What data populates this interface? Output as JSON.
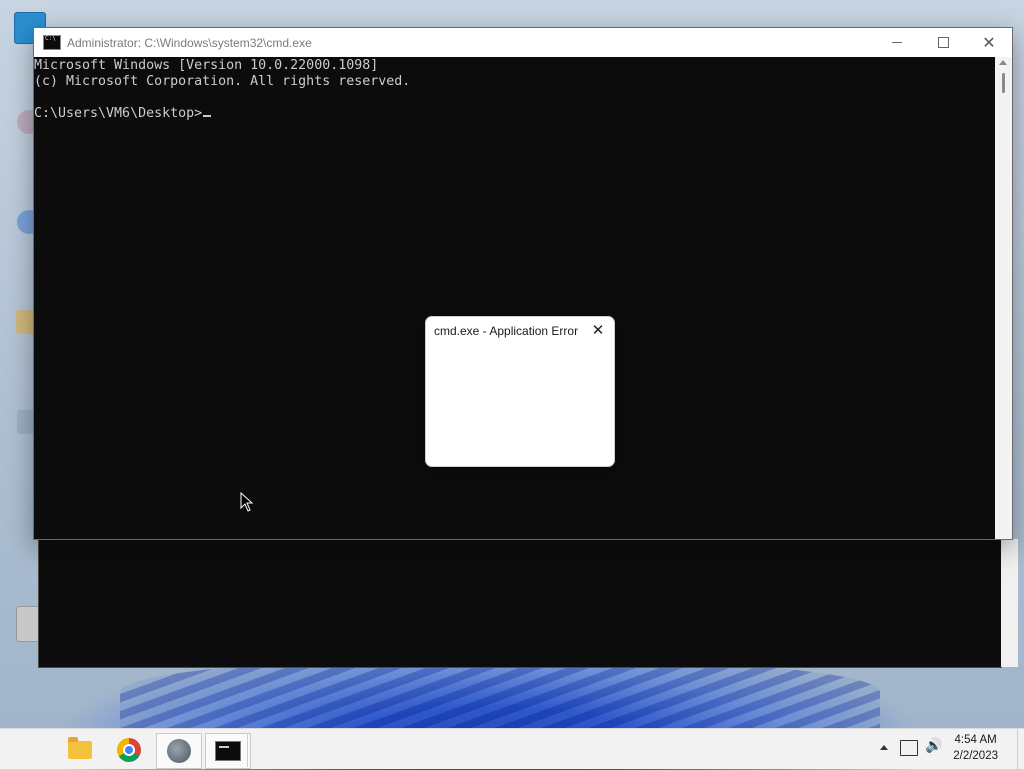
{
  "window": {
    "title": "Administrator: C:\\Windows\\system32\\cmd.exe",
    "minimize_icon": "minimize-icon",
    "maximize_icon": "maximize-icon",
    "close_glyph": "✕"
  },
  "console": {
    "lines": [
      "Microsoft Windows [Version 10.0.22000.1098]",
      "(c) Microsoft Corporation. All rights reserved.",
      "",
      "C:\\Users\\VM6\\Desktop>"
    ]
  },
  "dialog": {
    "title": "cmd.exe - Application Error",
    "close_glyph": "✕"
  },
  "taskbar": {
    "apps": [
      "file-explorer-icon",
      "chrome-icon",
      "steam-icon",
      "cmd-icon"
    ],
    "tray_volume_glyph": "🔊",
    "clock_time": "4:54 AM",
    "clock_date": "2/2/2023"
  },
  "colors": {
    "console_bg": "#0c0c0c",
    "console_text": "#cccccc",
    "taskbar_bg": "#f2f2f2"
  }
}
